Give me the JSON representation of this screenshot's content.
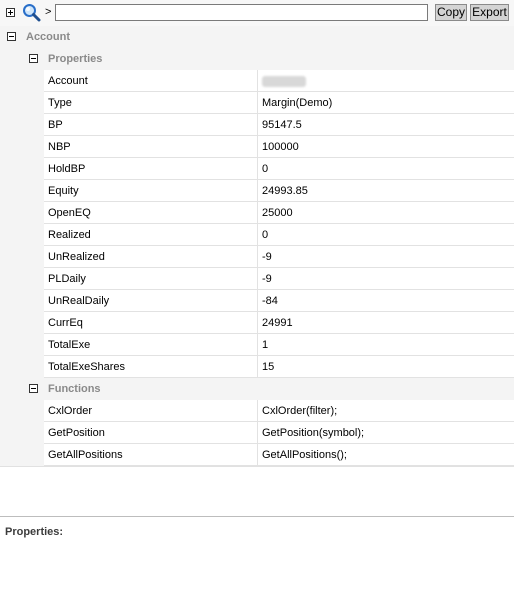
{
  "toolbar": {
    "prompt": ">",
    "command_value": "",
    "copy_label": "Copy",
    "export_label": "Export"
  },
  "tree": {
    "root_label": "Account",
    "properties": {
      "label": "Properties",
      "rows": [
        {
          "name": "Account",
          "value": ""
        },
        {
          "name": "Type",
          "value": "Margin(Demo)"
        },
        {
          "name": "BP",
          "value": "95147.5"
        },
        {
          "name": "NBP",
          "value": "100000"
        },
        {
          "name": "HoldBP",
          "value": "0"
        },
        {
          "name": "Equity",
          "value": "24993.85"
        },
        {
          "name": "OpenEQ",
          "value": "25000"
        },
        {
          "name": "Realized",
          "value": "0"
        },
        {
          "name": "UnRealized",
          "value": "-9"
        },
        {
          "name": "PLDaily",
          "value": "-9"
        },
        {
          "name": "UnRealDaily",
          "value": "-84"
        },
        {
          "name": "CurrEq",
          "value": "24991"
        },
        {
          "name": "TotalExe",
          "value": "1"
        },
        {
          "name": "TotalExeShares",
          "value": "15"
        }
      ]
    },
    "functions": {
      "label": "Functions",
      "rows": [
        {
          "name": "CxlOrder",
          "value": "CxlOrder(filter);"
        },
        {
          "name": "GetPosition",
          "value": "GetPosition(symbol);"
        },
        {
          "name": "GetAllPositions",
          "value": "GetAllPositions();"
        }
      ]
    }
  },
  "description": {
    "title": "Properties:"
  },
  "icons": {
    "expand": "plus-box-icon",
    "collapse": "minus-box-icon",
    "search": "magnifier-icon"
  },
  "colors": {
    "category_text": "#8a8a8a",
    "grid_line": "#e2e2e2",
    "button_bg": "#d4d4d4"
  }
}
